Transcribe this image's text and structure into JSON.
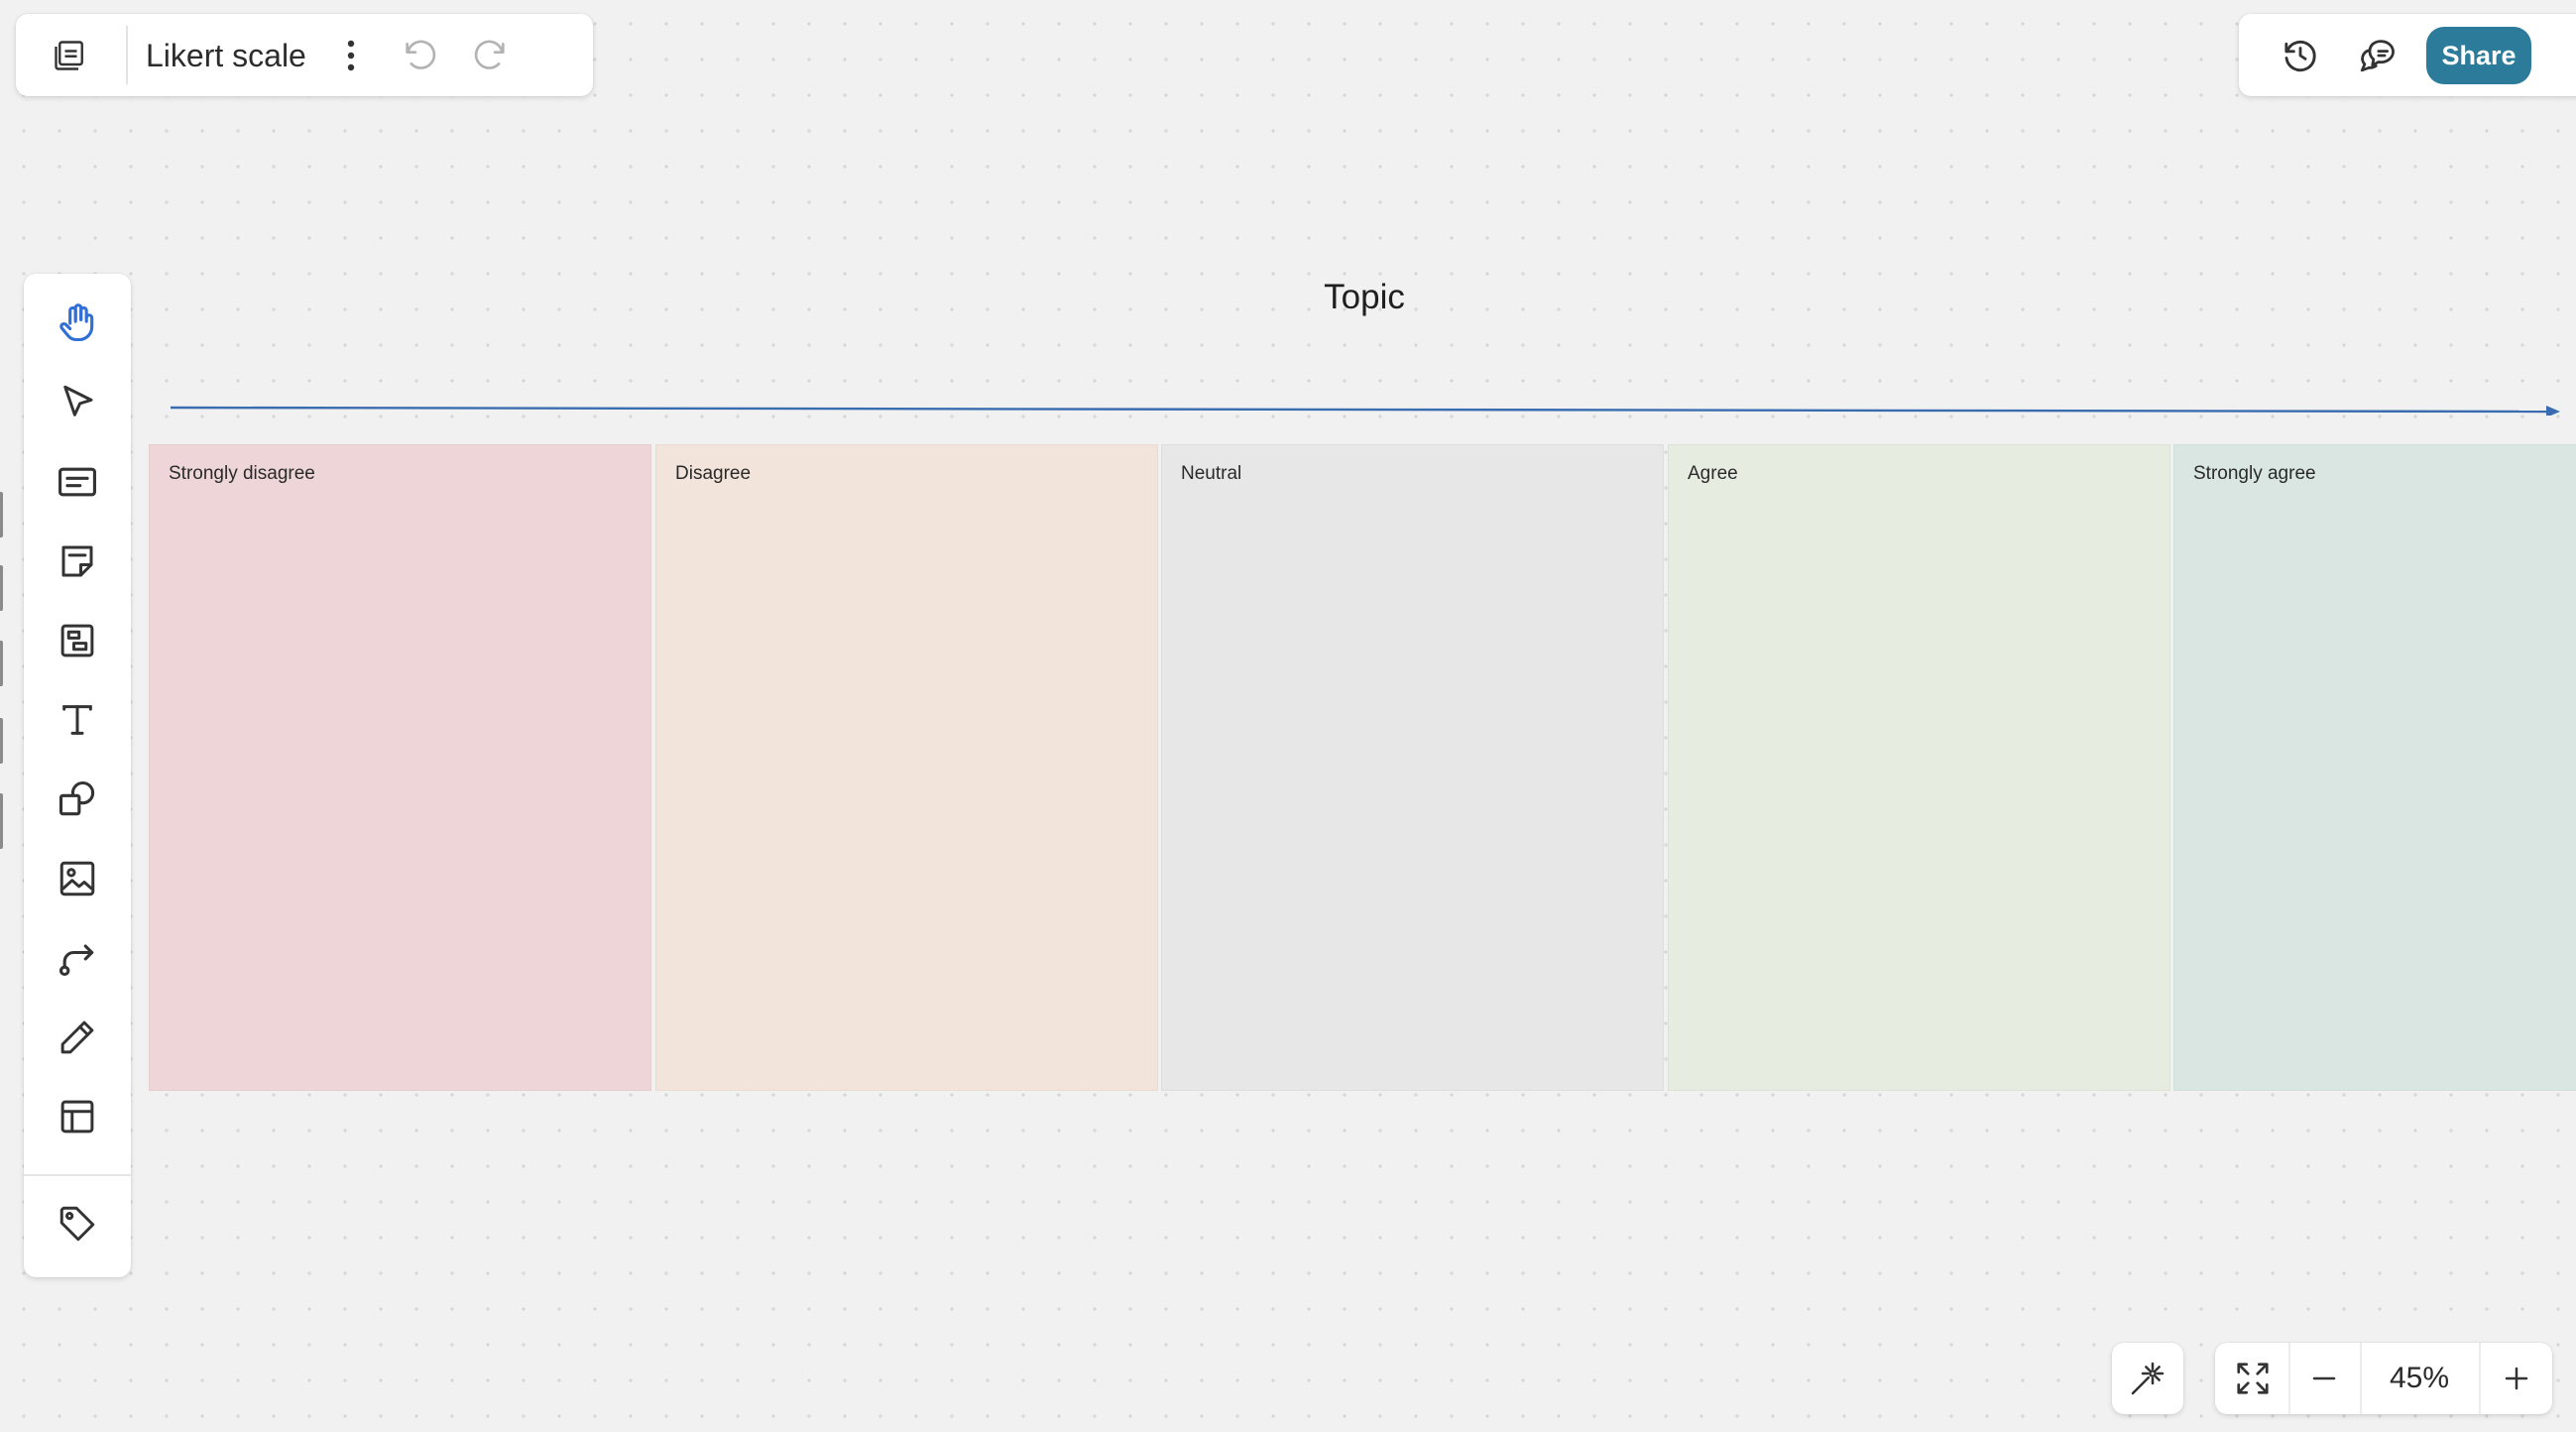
{
  "header": {
    "board_title": "Likert scale",
    "board_icon": "board-icon",
    "menu_icon": "more-vertical-icon",
    "undo_icon": "undo-icon",
    "redo_icon": "redo-icon",
    "history_icon": "history-icon",
    "comments_icon": "comments-icon",
    "share_label": "Share",
    "share_color": "#2d7b9b"
  },
  "toolbar": {
    "tools": [
      {
        "name": "hand",
        "icon": "hand-icon",
        "active": true
      },
      {
        "name": "select",
        "icon": "pointer-icon"
      },
      {
        "name": "card",
        "icon": "card-icon"
      },
      {
        "name": "sticky-note",
        "icon": "sticky-note-icon"
      },
      {
        "name": "frame",
        "icon": "frame-icon"
      },
      {
        "name": "text",
        "icon": "text-icon"
      },
      {
        "name": "shapes",
        "icon": "shapes-icon"
      },
      {
        "name": "image",
        "icon": "image-icon"
      },
      {
        "name": "connector",
        "icon": "connector-icon"
      },
      {
        "name": "pen",
        "icon": "pen-icon"
      },
      {
        "name": "templates",
        "icon": "templates-icon"
      },
      {
        "name": "tags",
        "icon": "tag-icon"
      }
    ],
    "active_color": "#2f6fd6"
  },
  "canvas": {
    "topic": "Topic",
    "axis_color": "#3a6db0",
    "columns": [
      {
        "label": "Strongly disagree",
        "color": "#eed6d8"
      },
      {
        "label": "Disagree",
        "color": "#f2e4da"
      },
      {
        "label": "Neutral",
        "color": "#e7e7e7"
      },
      {
        "label": "Agree",
        "color": "#e6ece0"
      },
      {
        "label": "Strongly agree",
        "color": "#d9e6e1"
      }
    ]
  },
  "controls": {
    "magic_icon": "sparkle-wand-icon",
    "fit_icon": "fit-screen-icon",
    "zoom_out_icon": "minus-icon",
    "zoom_level": "45%",
    "zoom_in_icon": "plus-icon"
  }
}
